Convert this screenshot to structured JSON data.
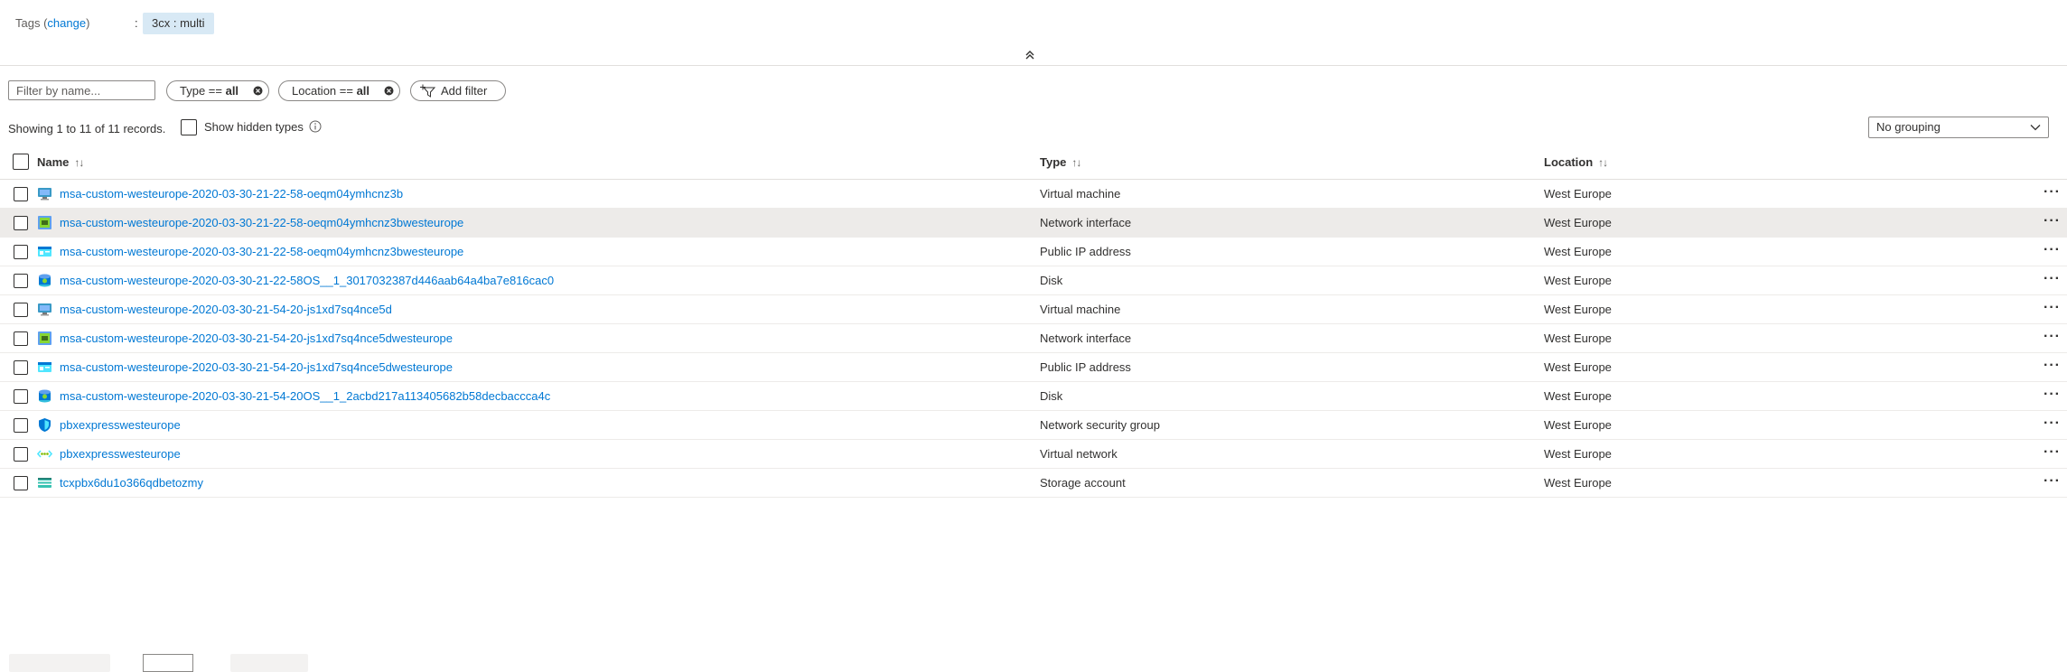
{
  "tags": {
    "label": "Tags",
    "change_link": "change",
    "colon": ":",
    "chip": "3cx : multi"
  },
  "filter": {
    "placeholder": "Filter by name...",
    "type_pill_prefix": "Type == ",
    "type_pill_value": "all",
    "location_pill_prefix": "Location == ",
    "location_pill_value": "all",
    "add_filter_label": "Add filter"
  },
  "records": {
    "showing_text": "Showing 1 to 11 of 11 records.",
    "show_hidden_label": "Show hidden types"
  },
  "grouping": {
    "selected": "No grouping"
  },
  "table": {
    "columns": [
      "Name",
      "Type",
      "Location"
    ],
    "sort_glyph": "↑↓",
    "rows": [
      {
        "name": "msa-custom-westeurope-2020-03-30-21-22-58-oeqm04ymhcnz3b",
        "type": "Virtual machine",
        "location": "West Europe",
        "icon": "virtual-machine-icon"
      },
      {
        "name": "msa-custom-westeurope-2020-03-30-21-22-58-oeqm04ymhcnz3bwesteurope",
        "type": "Network interface",
        "location": "West Europe",
        "icon": "network-interface-icon"
      },
      {
        "name": "msa-custom-westeurope-2020-03-30-21-22-58-oeqm04ymhcnz3bwesteurope",
        "type": "Public IP address",
        "location": "West Europe",
        "icon": "public-ip-icon"
      },
      {
        "name": "msa-custom-westeurope-2020-03-30-21-22-58OS__1_3017032387d446aab64a4ba7e816cac0",
        "type": "Disk",
        "location": "West Europe",
        "icon": "disk-icon"
      },
      {
        "name": "msa-custom-westeurope-2020-03-30-21-54-20-js1xd7sq4nce5d",
        "type": "Virtual machine",
        "location": "West Europe",
        "icon": "virtual-machine-icon"
      },
      {
        "name": "msa-custom-westeurope-2020-03-30-21-54-20-js1xd7sq4nce5dwesteurope",
        "type": "Network interface",
        "location": "West Europe",
        "icon": "network-interface-icon"
      },
      {
        "name": "msa-custom-westeurope-2020-03-30-21-54-20-js1xd7sq4nce5dwesteurope",
        "type": "Public IP address",
        "location": "West Europe",
        "icon": "public-ip-icon"
      },
      {
        "name": "msa-custom-westeurope-2020-03-30-21-54-20OS__1_2acbd217a113405682b58decbaccca4c",
        "type": "Disk",
        "location": "West Europe",
        "icon": "disk-icon"
      },
      {
        "name": "pbxexpresswesteurope",
        "type": "Network security group",
        "location": "West Europe",
        "icon": "network-security-group-icon"
      },
      {
        "name": "pbxexpresswesteurope",
        "type": "Virtual network",
        "location": "West Europe",
        "icon": "virtual-network-icon"
      },
      {
        "name": "tcxpbx6du1o366qdbetozmy",
        "type": "Storage account",
        "location": "West Europe",
        "icon": "storage-account-icon"
      }
    ],
    "more_glyph": "···"
  },
  "colors": {
    "link": "#0078d4",
    "row_highlight": "#edebe9",
    "tag_chip": "#d8e9f5"
  }
}
